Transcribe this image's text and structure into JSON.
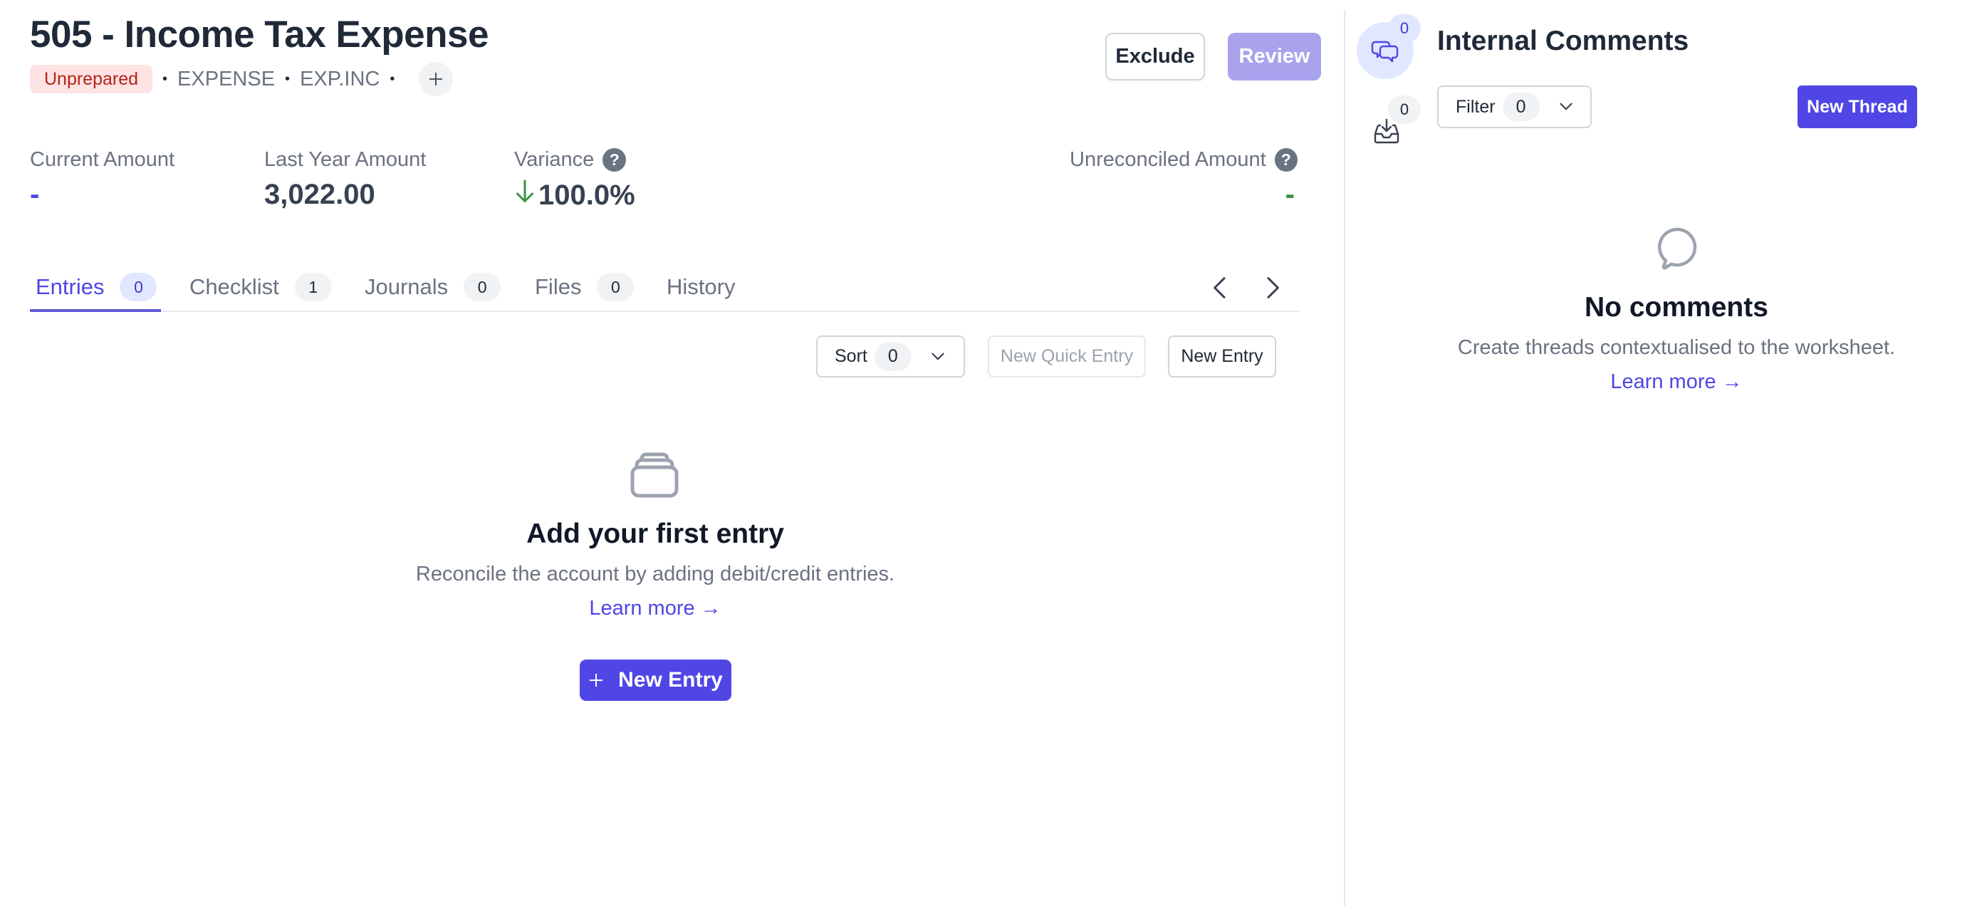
{
  "header": {
    "title": "505 - Income Tax Expense",
    "status_badge": "Unprepared",
    "tags": [
      "EXPENSE",
      "EXP.INC"
    ],
    "separator": "•",
    "add_tag_icon": "plus-icon",
    "exclude_label": "Exclude",
    "review_label": "Review"
  },
  "amounts": {
    "current": {
      "label": "Current Amount",
      "value": "-"
    },
    "last_year": {
      "label": "Last Year Amount",
      "value": "3,022.00"
    },
    "variance": {
      "label": "Variance",
      "value": "100.0%",
      "direction": "down",
      "help": "?"
    },
    "unreconciled": {
      "label": "Unreconciled Amount",
      "value": "-",
      "help": "?"
    }
  },
  "tabs": [
    {
      "label": "Entries",
      "count": "0",
      "active": true
    },
    {
      "label": "Checklist",
      "count": "1"
    },
    {
      "label": "Journals",
      "count": "0"
    },
    {
      "label": "Files",
      "count": "0"
    },
    {
      "label": "History"
    }
  ],
  "toolbar": {
    "sort_label": "Sort",
    "sort_count": "0",
    "quick_entry_label": "New Quick Entry",
    "new_entry_label": "New Entry"
  },
  "empty_state": {
    "icon": "archive-stack-icon",
    "title": "Add your first entry",
    "description": "Reconcile the account by adding debit/credit entries.",
    "link": "Learn more →",
    "button_label": "New Entry"
  },
  "comments_panel": {
    "comments_badge": "0",
    "inbox_badge": "0",
    "title": "Internal Comments",
    "filter_label": "Filter",
    "filter_count": "0",
    "new_thread_label": "New Thread",
    "empty_title": "No comments",
    "empty_description": "Create threads contextualised to the worksheet.",
    "empty_link": "Learn more →"
  },
  "colors": {
    "accent": "#4f46e5",
    "status_unprepared_bg": "#fde3e3",
    "status_unprepared_text": "#b42318",
    "positive": "#3f9142",
    "review_disabled": "#a8a3ec"
  }
}
